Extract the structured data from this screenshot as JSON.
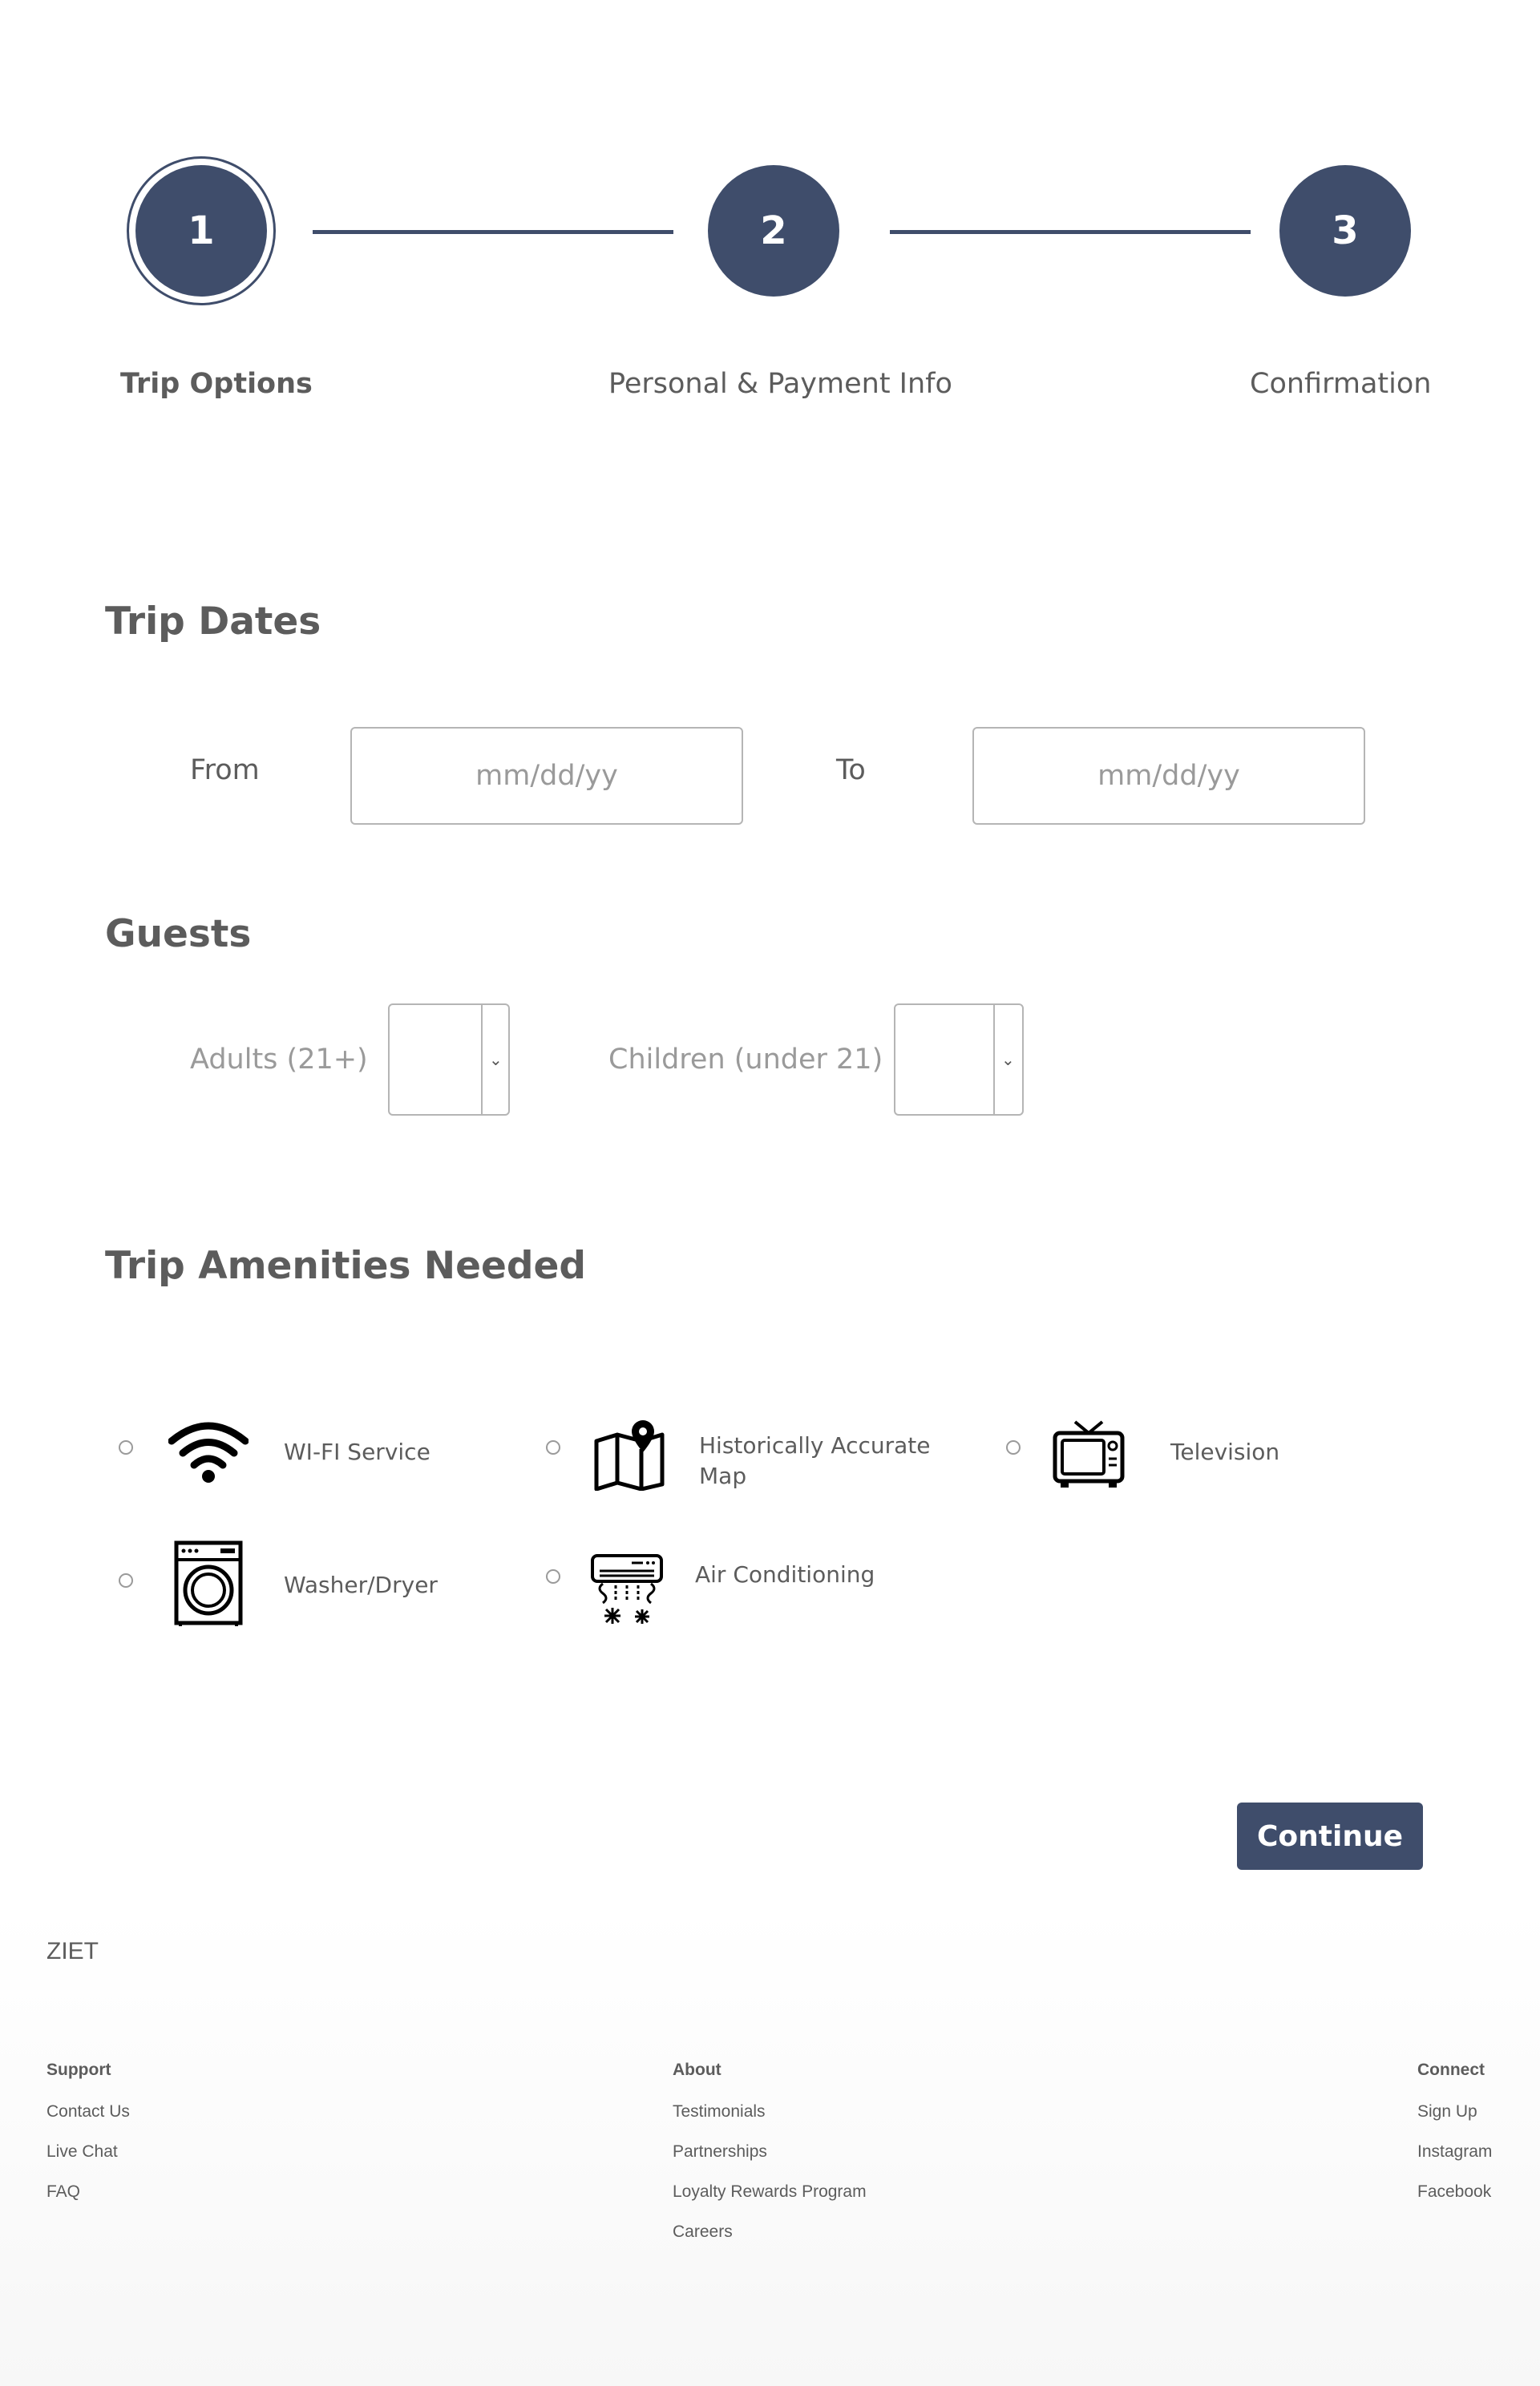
{
  "stepper": {
    "steps": [
      {
        "number": "1",
        "label": "Trip Options",
        "active": true
      },
      {
        "number": "2",
        "label": "Personal & Payment Info",
        "active": false
      },
      {
        "number": "3",
        "label": "Confirmation",
        "active": false
      }
    ]
  },
  "trip_dates": {
    "title": "Trip Dates",
    "from_label": "From",
    "from_placeholder": "mm/dd/yy",
    "to_label": "To",
    "to_placeholder": "mm/dd/yy"
  },
  "guests": {
    "title": "Guests",
    "adults_label": "Adults (21+)",
    "adults_value": "",
    "children_label": "Children (under 21)",
    "children_value": ""
  },
  "amenities": {
    "title": "Trip Amenities Needed",
    "items": [
      {
        "label": "WI-FI Service",
        "icon": "wifi-icon",
        "checked": false
      },
      {
        "label": "Historically Accurate Map",
        "icon": "map-pin-icon",
        "checked": false
      },
      {
        "label": "Television",
        "icon": "television-icon",
        "checked": false
      },
      {
        "label": "Washer/Dryer",
        "icon": "washing-machine-icon",
        "checked": false
      },
      {
        "label": "Air Conditioning",
        "icon": "air-conditioner-icon",
        "checked": false
      }
    ]
  },
  "actions": {
    "continue_label": "Continue"
  },
  "footer": {
    "brand": "ZIET",
    "columns": [
      {
        "heading": "Support",
        "links": [
          "Contact Us",
          "Live Chat",
          "FAQ"
        ]
      },
      {
        "heading": "About",
        "links": [
          "Testimonials",
          "Partnerships",
          "Loyalty Rewards Program",
          "Careers"
        ]
      },
      {
        "heading": "Connect",
        "links": [
          "Sign Up",
          "Instagram",
          "Facebook"
        ]
      }
    ]
  },
  "colors": {
    "primary": "#3f4d6b",
    "text": "#5c5c5c",
    "muted_text": "#9a9a9a",
    "border": "#b5b5b5"
  }
}
